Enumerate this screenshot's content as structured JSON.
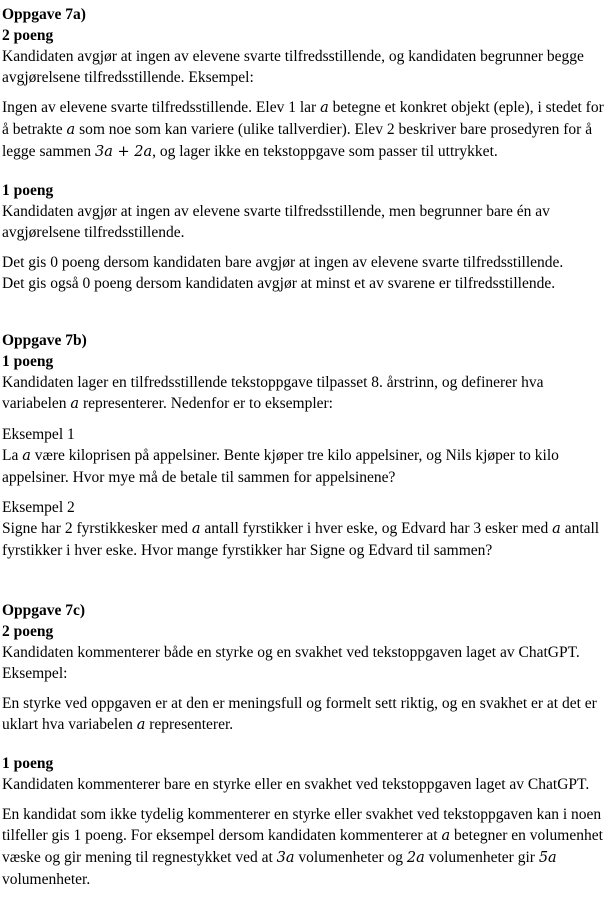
{
  "oppgave_7a": {
    "title": "Oppgave 7a)",
    "p2": {
      "points": "2 poeng",
      "intro": "Kandidaten avgjør at ingen av elevene svarte tilfredsstillende, og kandidaten begrunner begge avgjørelsene tilfredsstillende. Eksempel:",
      "example_a": "Ingen av elevene svarte tilfredsstillende. Elev 1 lar ",
      "example_var1": "a",
      "example_b": " betegne et konkret objekt (eple), i stedet for å betrakte ",
      "example_var2": "a",
      "example_c": " som noe som kan variere (ulike tallverdier). Elev 2 beskriver bare prosedyren for å legge sammen ",
      "example_expr": "3a + 2a",
      "example_d": ", og lager ikke en tekstoppgave som passer til uttrykket."
    },
    "p1": {
      "points": "1 poeng",
      "text": "Kandidaten avgjør at ingen av elevene svarte tilfredsstillende, men begrunner bare én av avgjørelsene tilfredsstillende.",
      "note1": "Det gis 0 poeng dersom kandidaten bare avgjør at ingen av elevene svarte tilfredsstillende.",
      "note2": "Det gis også 0 poeng dersom kandidaten avgjør at minst et av svarene er tilfredsstillende."
    }
  },
  "oppgave_7b": {
    "title": "Oppgave 7b)",
    "points": "1 poeng",
    "intro_a": "Kandidaten lager en tilfredsstillende tekstoppgave tilpasset 8. årstrinn, og definerer hva variabelen ",
    "intro_var": "a",
    "intro_b": " representerer. Nedenfor er to eksempler:",
    "ex1_label": "Eksempel 1",
    "ex1_a": "La ",
    "ex1_var": "a",
    "ex1_b": " være kiloprisen på appelsiner. Bente kjøper tre kilo appelsiner, og Nils kjøper to kilo appelsiner. Hvor mye må de betale til sammen for appelsinene?",
    "ex2_label": "Eksempel 2",
    "ex2_a": "Signe har 2 fyrstikkesker med ",
    "ex2_var1": "a",
    "ex2_b": " antall fyrstikker i hver eske, og Edvard har 3 esker med ",
    "ex2_var2": "a",
    "ex2_c": " antall fyrstikker i hver eske. Hvor mange fyrstikker har Signe og Edvard til sammen?"
  },
  "oppgave_7c": {
    "title": "Oppgave 7c)",
    "p2": {
      "points": "2 poeng",
      "intro": "Kandidaten kommenterer både en styrke og en svakhet ved tekstoppgaven laget av ChatGPT. Eksempel:",
      "example_a": "En styrke ved oppgaven er at den er meningsfull og formelt sett riktig, og en svakhet er at det er uklart hva variabelen ",
      "example_var": "a",
      "example_b": " representerer."
    },
    "p1": {
      "points": "1 poeng",
      "text": "Kandidaten kommenterer bare en styrke eller en svakhet ved tekstoppgaven laget av ChatGPT.",
      "note_a": "En kandidat som ikke tydelig kommenterer en styrke eller svakhet ved tekstoppgaven kan i noen tilfeller gis 1 poeng. For eksempel dersom kandidaten kommenterer at ",
      "note_var": "a",
      "note_b": " betegner en volumenhet væske og gir mening til regnestykket ved at ",
      "note_expr1": "3a",
      "note_c": " volumenheter og ",
      "note_expr2": "2a",
      "note_d": " volumenheter gir ",
      "note_expr3": "5a",
      "note_e": " volumenheter."
    }
  }
}
